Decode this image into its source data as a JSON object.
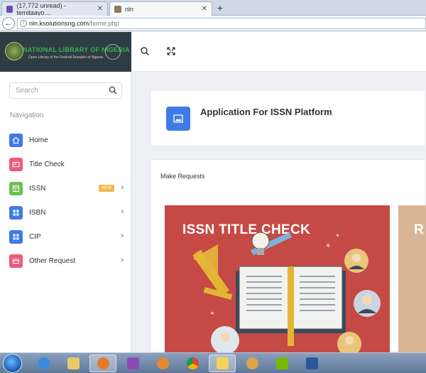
{
  "browser": {
    "tabs": [
      {
        "label": "(17,772 unread) - temitaayo…",
        "active": false
      },
      {
        "label": "nln",
        "active": true
      }
    ],
    "url_host": "nln.ksolutionsng.com",
    "url_path": "/home.php"
  },
  "brand": {
    "title": "NATIONAL LIBRARY OF NIGERIA",
    "subtitle": "Open Library of the Federal Republic of Nigeria"
  },
  "search": {
    "placeholder": "Search"
  },
  "navigation": {
    "heading": "Navigation",
    "items": [
      {
        "label": "Home",
        "icon": "home-icon",
        "color": "#3f7be6",
        "chevron": false
      },
      {
        "label": "Title Check",
        "icon": "card-icon",
        "color": "#ef5a7a",
        "chevron": false
      },
      {
        "label": "ISSN",
        "icon": "layout-icon",
        "color": "#6bbf4e",
        "chevron": true,
        "badge": "NEW"
      },
      {
        "label": "ISBN",
        "icon": "grid-icon",
        "color": "#3f7be6",
        "chevron": true
      },
      {
        "label": "CIP",
        "icon": "grid-icon",
        "color": "#3f7be6",
        "chevron": true
      },
      {
        "label": "Other Request",
        "icon": "crown-icon",
        "color": "#ef5a7a",
        "chevron": true
      }
    ]
  },
  "main": {
    "page_title": "Application For ISSN Platform",
    "section_title": "Make Requests",
    "promo_title": "ISSN TITLE CHECK",
    "promo2_title": "R"
  },
  "colors": {
    "sidebar_header": "#2f3c44",
    "accent_blue": "#3f7be6",
    "promo_red": "#c54a45",
    "badge_orange": "#f3b64a"
  }
}
